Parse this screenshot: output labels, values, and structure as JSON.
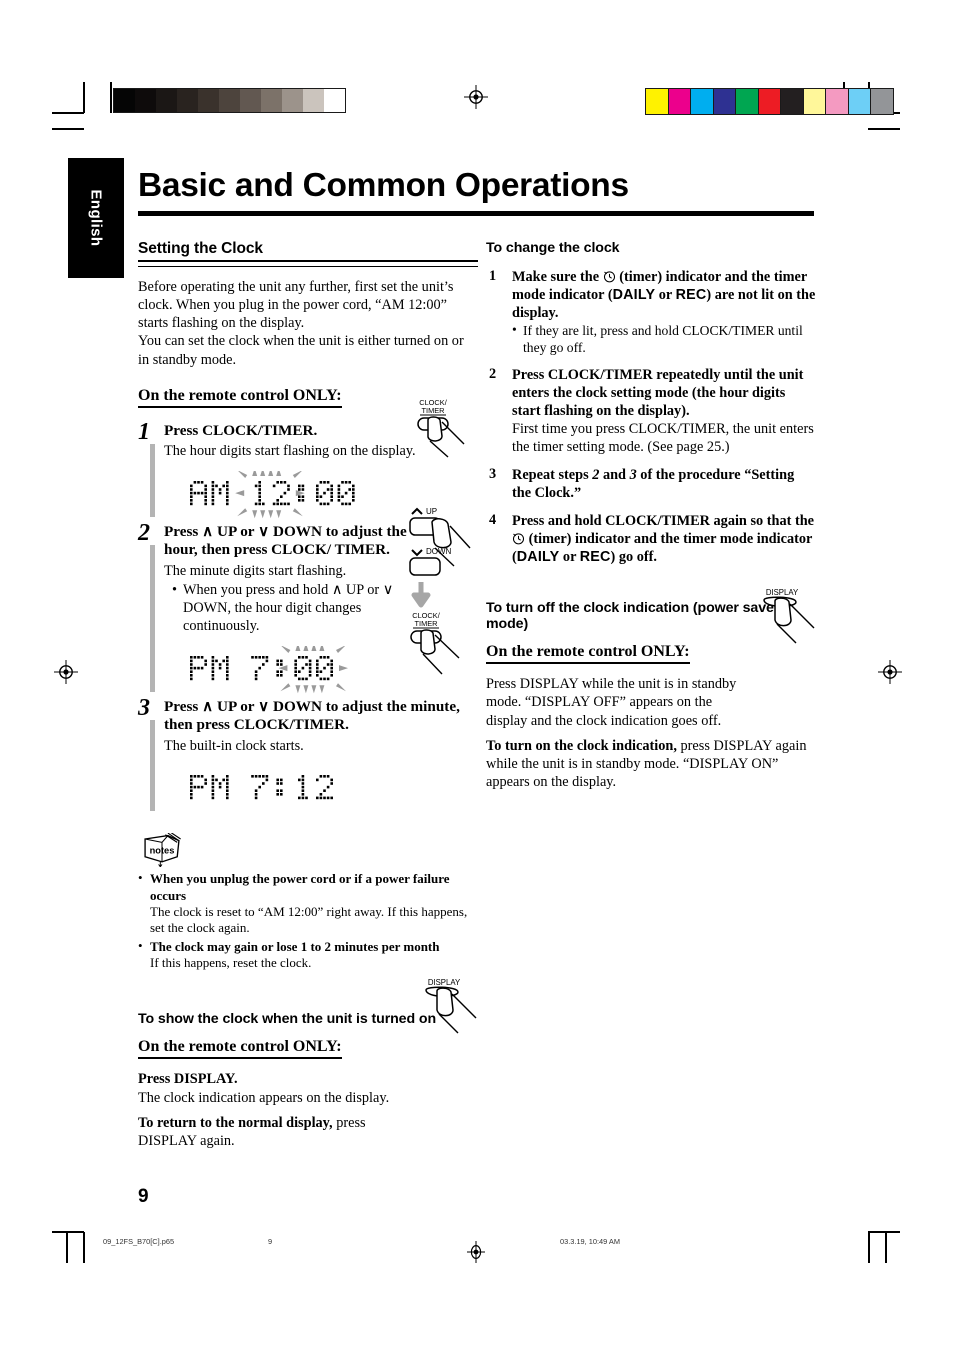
{
  "page": {
    "title": "Basic and Common Operations",
    "language_tab": "English",
    "page_number": "9"
  },
  "footer": {
    "file": "09_12FS_B70[C].p65",
    "page": "9",
    "date": "03.3.19, 10:49 AM"
  },
  "left_column": {
    "section_title": "Setting the Clock",
    "intro": [
      "Before operating the unit any further, first set the unit’s clock. When you plug in the power cord, “AM 12:00” starts flashing on the display.",
      "You can set the clock when the unit is either turned on or in standby mode."
    ],
    "remote_only": "On the remote control ONLY:",
    "steps": [
      {
        "num": "1",
        "head": "Press CLOCK/TIMER.",
        "body": "The hour digits start flashing on the display.",
        "bullets": [],
        "button_label": "CLOCK/\nTIMER",
        "lcd": {
          "ampm": "AM",
          "hour": "12",
          "minute": "00",
          "flash": "hour"
        }
      },
      {
        "num": "2",
        "head": "Press ∧ UP or ∨ DOWN to adjust the hour, then press CLOCK/ TIMER.",
        "body": "The minute digits start flashing.",
        "bullets": [
          "When you press and hold ∧ UP or ∨ DOWN, the hour digit changes continuously."
        ],
        "button_labels": [
          "UP",
          "DOWN",
          "CLOCK/\nTIMER"
        ],
        "lcd": {
          "ampm": "PM",
          "hour": "7",
          "minute": "00",
          "flash": "minute"
        }
      },
      {
        "num": "3",
        "head": "Press ∧ UP or ∨ DOWN to adjust the minute, then press CLOCK/TIMER.",
        "body": "The built-in clock starts.",
        "bullets": [],
        "lcd": {
          "ampm": "PM",
          "hour": "7",
          "minute": "12",
          "flash": "none"
        }
      }
    ],
    "notes_icon_label": "notes",
    "notes": [
      {
        "title": "When you unplug the power cord or if a power failure occurs",
        "text": "The clock is reset to “AM 12:00” right away. If this happens, set the clock again."
      },
      {
        "title": "The clock may gain or lose 1 to 2 minutes per month",
        "text": "If this happens, reset the clock."
      }
    ],
    "show_clock": {
      "heading": "To show the clock when the unit is turned on",
      "remote_only": "On the remote control ONLY:",
      "press_bold": "Press DISPLAY.",
      "press_body": "The clock indication appears on the display.",
      "return_bold": "To return to the normal display,",
      "return_rest": " press DISPLAY again.",
      "button_label": "DISPLAY"
    }
  },
  "right_column": {
    "change_clock": {
      "heading": "To change the clock",
      "steps": [
        {
          "num": "1",
          "bold_a": "Make sure the ",
          "icon": "clock-timer-icon",
          "bold_b": " (timer) indicator and the timer mode indicator (",
          "mode_a": "DAILY",
          "bold_c": " or ",
          "mode_b": "REC",
          "bold_d": ") are not lit on the display.",
          "bullets": [
            "If they are lit, press and hold CLOCK/TIMER until they go off."
          ]
        },
        {
          "num": "2",
          "bold_a": "Press CLOCK/TIMER repeatedly until the unit enters the clock setting mode (the hour digits start flashing on the display).",
          "plain": "First time you press CLOCK/TIMER, the unit enters the timer setting mode. (See page 25.)"
        },
        {
          "num": "3",
          "bold_a": "Repeat steps ",
          "italic_a": "2",
          "bold_b": " and ",
          "italic_b": "3",
          "bold_c": " of the procedure “Setting the Clock.”"
        },
        {
          "num": "4",
          "bold_a": "Press and hold CLOCK/TIMER again so that the ",
          "icon": "clock-timer-icon",
          "bold_b": " (timer) indicator and the timer mode indicator (",
          "mode_a": "DAILY",
          "bold_c": " or ",
          "mode_b": "REC",
          "bold_d": ") go off."
        }
      ]
    },
    "power_save": {
      "heading": "To turn off the clock indication (power save mode)",
      "remote_only": "On the remote control ONLY:",
      "para1": "Press DISPLAY while the unit is in standby mode. “DISPLAY OFF” appears on the display and the clock indication goes off.",
      "turn_on_bold": "To turn on the clock indication,",
      "turn_on_rest": " press DISPLAY again while the unit is in standby mode. “DISPLAY ON” appears on the display.",
      "button_label": "DISPLAY"
    }
  },
  "print_marks": {
    "grayscale_bar": [
      "#050505",
      "#0e0b0b",
      "#1b1715",
      "#29231f",
      "#3a322c",
      "#4d443d",
      "#625851",
      "#7c7269",
      "#9c938b",
      "#cbc4bd",
      "#ffffff"
    ],
    "color_bar": [
      "#fff200",
      "#ec008c",
      "#00aeef",
      "#2e3192",
      "#00a651",
      "#ed1c24",
      "#231f20",
      "#fff79a",
      "#f49ac1",
      "#6dcff6",
      "#939598"
    ]
  }
}
